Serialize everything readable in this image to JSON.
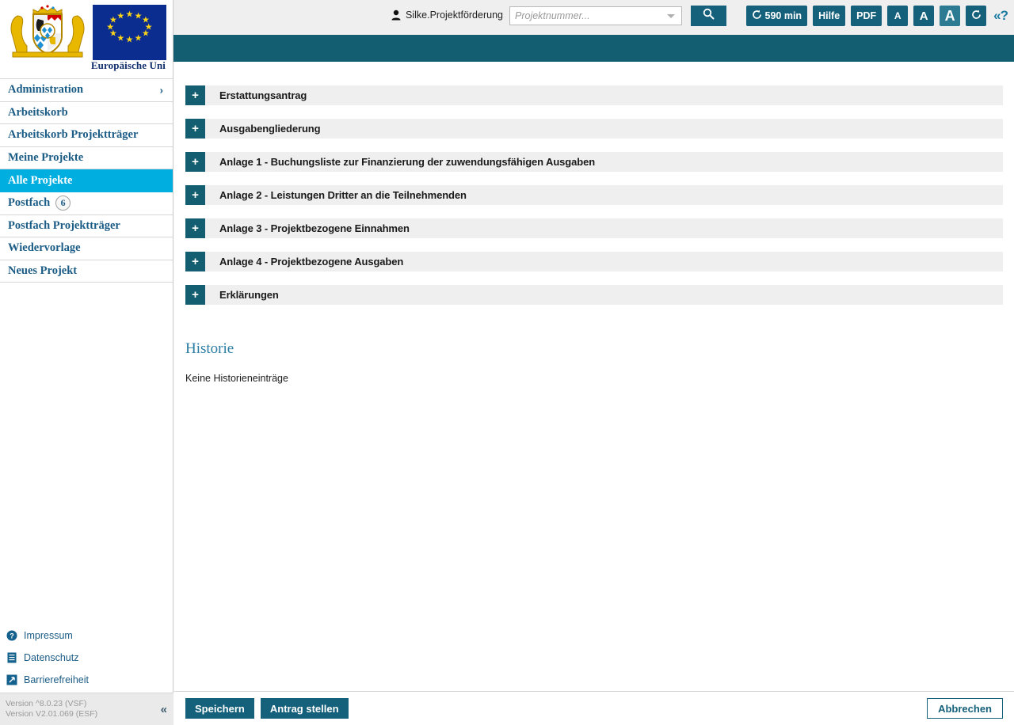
{
  "header": {
    "user_name": "Silke.Projektförderung",
    "user_icon": "person-icon",
    "search_placeholder": "Projektnummer...",
    "search_value": "",
    "search_button_icon": "search-icon",
    "tools": {
      "session_timer": "590 min",
      "session_icon": "refresh-icon",
      "help_label": "Hilfe",
      "pdf_label": "PDF",
      "font_small": "A",
      "font_medium": "A",
      "font_large": "A",
      "reload_icon": "refresh-icon",
      "context_help": "«?"
    }
  },
  "sidebar": {
    "logo_crest": "bavaria-coat-of-arms",
    "logo_flag": "european-union-flag",
    "eu_caption": "Europäische Uni",
    "items": [
      {
        "label": "Administration",
        "active": false,
        "chevron": "›",
        "badge": null
      },
      {
        "label": "Arbeitskorb",
        "active": false,
        "chevron": null,
        "badge": null
      },
      {
        "label": "Arbeitskorb Projektträger",
        "active": false,
        "chevron": null,
        "badge": null
      },
      {
        "label": "Meine Projekte",
        "active": false,
        "chevron": null,
        "badge": null
      },
      {
        "label": "Alle Projekte",
        "active": true,
        "chevron": null,
        "badge": null
      },
      {
        "label": "Postfach",
        "active": false,
        "chevron": null,
        "badge": "6"
      },
      {
        "label": "Postfach Projektträger",
        "active": false,
        "chevron": null,
        "badge": null
      },
      {
        "label": "Wiedervorlage",
        "active": false,
        "chevron": null,
        "badge": null
      },
      {
        "label": "Neues Projekt",
        "active": false,
        "chevron": null,
        "badge": null
      }
    ],
    "footer_links": [
      {
        "label": "Impressum",
        "icon": "question-circle-icon"
      },
      {
        "label": "Datenschutz",
        "icon": "document-icon"
      },
      {
        "label": "Barrierefreiheit",
        "icon": "accessibility-icon"
      }
    ],
    "version_text": "Version ^8.0.23 (VSF)\nVersion V2.01.069 (ESF)",
    "collapse_icon": "«"
  },
  "main": {
    "panels": [
      {
        "toggle": "+",
        "title": "Erstattungsantrag"
      },
      {
        "toggle": "+",
        "title": "Ausgabengliederung"
      },
      {
        "toggle": "+",
        "title": "Anlage 1 - Buchungsliste zur Finanzierung der zuwendungsfähigen Ausgaben"
      },
      {
        "toggle": "+",
        "title": "Anlage 2 - Leistungen Dritter an die Teilnehmenden"
      },
      {
        "toggle": "+",
        "title": "Anlage 3 - Projektbezogene Einnahmen"
      },
      {
        "toggle": "+",
        "title": "Anlage 4 - Projektbezogene Ausgaben"
      },
      {
        "toggle": "+",
        "title": "Erklärungen"
      }
    ],
    "history_heading": "Historie",
    "history_empty": "Keine Historieneinträge"
  },
  "footer_bar": {
    "save_label": "Speichern",
    "submit_label": "Antrag stellen",
    "cancel_label": "Abbrechen"
  },
  "colors": {
    "teal": "#135e70",
    "teal_button": "#15607a",
    "active_cyan": "#00aee0",
    "panel_grey": "#efefef",
    "link_blue": "#1b5c86",
    "heading_blue": "#2a7ca3"
  }
}
